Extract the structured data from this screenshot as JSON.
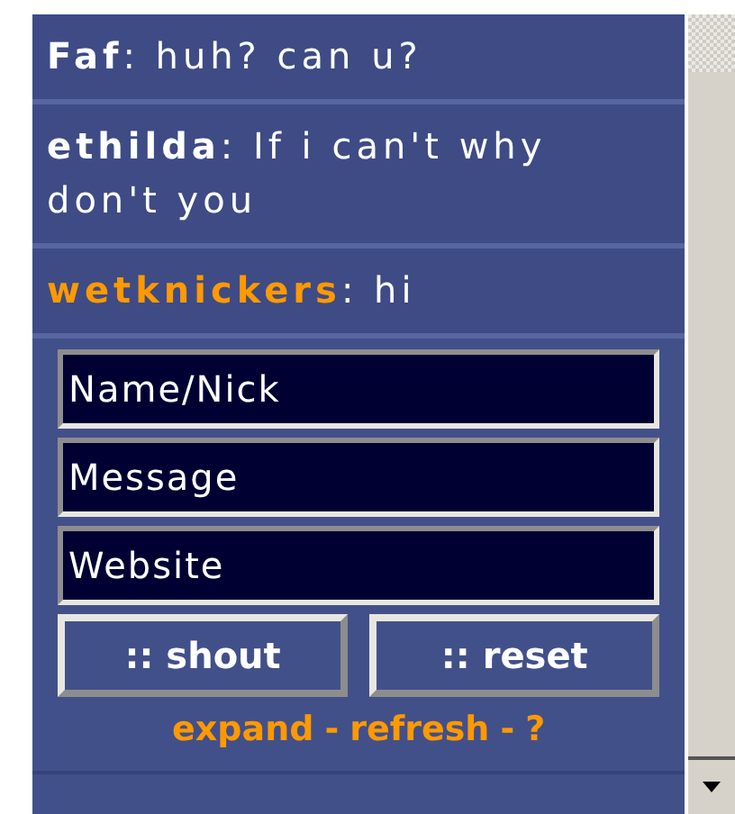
{
  "messages": [
    {
      "name": "Faf",
      "color": "#ffffff",
      "text": "huh? can u?"
    },
    {
      "name": "ethilda",
      "color": "#ffffff",
      "text": "If i can't why don't you"
    },
    {
      "name": "wetknickers",
      "color": "#ff9900",
      "text": "hi"
    }
  ],
  "name_separator": ":",
  "form": {
    "fields": [
      {
        "placeholder": "Name/Nick"
      },
      {
        "placeholder": "Message"
      },
      {
        "placeholder": "Website"
      }
    ],
    "buttons": [
      ":: shout",
      ":: reset"
    ],
    "links": [
      "expand",
      "refresh",
      "?"
    ],
    "separator": "-"
  }
}
